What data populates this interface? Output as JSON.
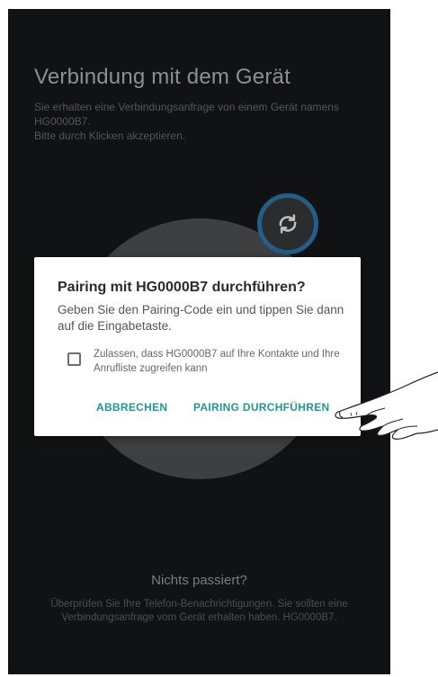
{
  "background": {
    "title": "Verbindung mit dem Gerät",
    "subtitle_line1": "Sie erhalten eine Verbindungsanfrage von einem Gerät namens HG0000B7.",
    "subtitle_line2": "Bitte durch Klicken akzeptieren.",
    "sync_icon": "sync-icon",
    "bottom_title": "Nichts passiert?",
    "bottom_text": "Überprüfen Sie Ihre Telefon-Benachrichtigungen. Sie sollten eine Verbindungsanfrage vom Gerät erhalten haben. HG0000B7."
  },
  "dialog": {
    "title": "Pairing mit HG0000B7 durchführen?",
    "message": "Geben Sie den Pairing-Code ein und tippen Sie dann auf die Eingabetaste.",
    "checkbox_label": "Zulassen, dass HG0000B7 auf Ihre Kontakte und Ihre Anrufliste zugreifen kann",
    "checkbox_checked": false,
    "cancel_label": "ABBRECHEN",
    "confirm_label": "PAIRING DURCHFÜHREN"
  },
  "overlay": {
    "pointer": "hand-pointer-icon"
  },
  "colors": {
    "screen_background": "#111213",
    "accent": "#1d9a8c",
    "sync_ring": "#1f5f88"
  }
}
